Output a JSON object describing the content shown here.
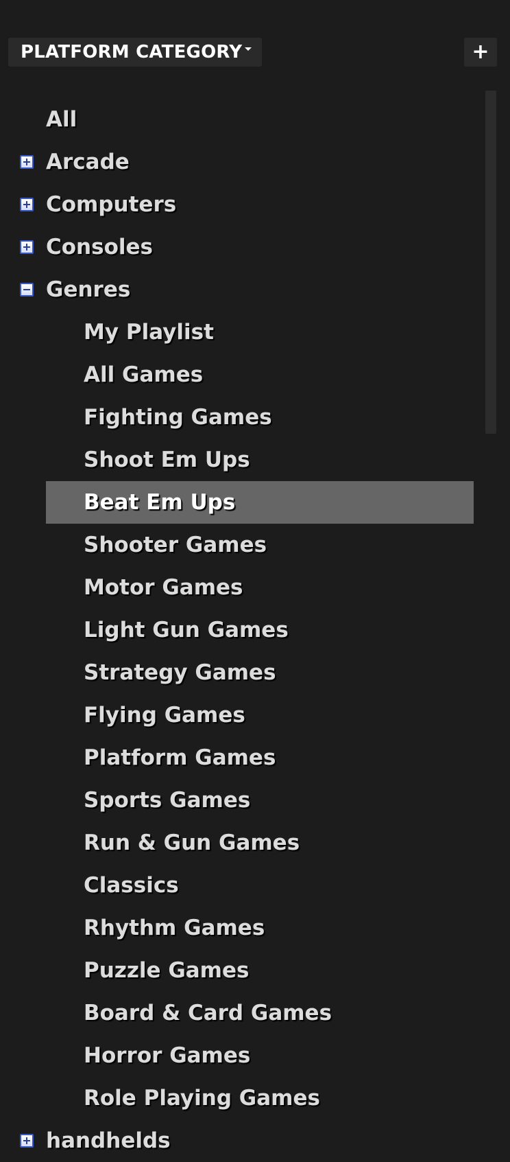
{
  "header": {
    "title": "PLATFORM CATEGORY",
    "add_label": "+"
  },
  "tree": [
    {
      "label": "All",
      "level": 0,
      "toggle": "none"
    },
    {
      "label": "Arcade",
      "level": 0,
      "toggle": "plus"
    },
    {
      "label": "Computers",
      "level": 0,
      "toggle": "plus"
    },
    {
      "label": "Consoles",
      "level": 0,
      "toggle": "plus"
    },
    {
      "label": "Genres",
      "level": 0,
      "toggle": "minus"
    },
    {
      "label": "My Playlist",
      "level": 1
    },
    {
      "label": "All Games",
      "level": 1
    },
    {
      "label": "Fighting Games",
      "level": 1
    },
    {
      "label": "Shoot Em Ups",
      "level": 1
    },
    {
      "label": "Beat Em Ups",
      "level": 1,
      "selected": true
    },
    {
      "label": "Shooter Games",
      "level": 1
    },
    {
      "label": "Motor Games",
      "level": 1
    },
    {
      "label": "Light Gun Games",
      "level": 1
    },
    {
      "label": "Strategy Games",
      "level": 1
    },
    {
      "label": "Flying Games",
      "level": 1
    },
    {
      "label": "Platform Games",
      "level": 1
    },
    {
      "label": "Sports Games",
      "level": 1
    },
    {
      "label": "Run & Gun Games",
      "level": 1
    },
    {
      "label": "Classics",
      "level": 1
    },
    {
      "label": "Rhythm Games",
      "level": 1
    },
    {
      "label": "Puzzle Games",
      "level": 1
    },
    {
      "label": "Board & Card Games",
      "level": 1
    },
    {
      "label": "Horror Games",
      "level": 1
    },
    {
      "label": "Role Playing Games",
      "level": 1
    },
    {
      "label": "handhelds",
      "level": 0,
      "toggle": "plus"
    }
  ],
  "colors": {
    "background": "#1c1c1c",
    "selection": "#666666",
    "text": "#dcdcdc"
  }
}
